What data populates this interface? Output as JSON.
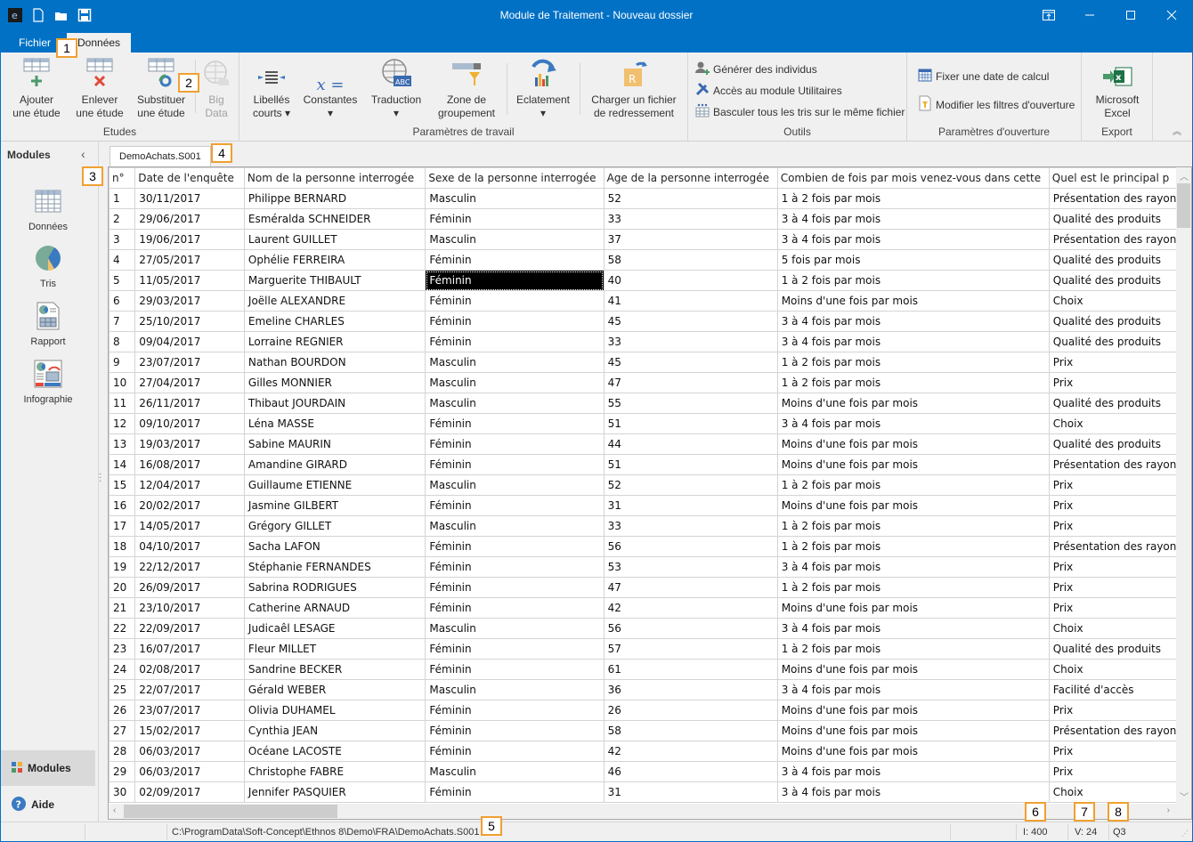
{
  "window": {
    "title": "Module de Traitement - Nouveau dossier",
    "qat": [
      "app-logo-icon",
      "new-file-icon",
      "open-folder-icon",
      "save-icon"
    ],
    "controls": [
      "ribbon-display-icon",
      "minimize-icon",
      "maximize-icon",
      "close-icon"
    ]
  },
  "tabs": [
    {
      "label": "Fichier"
    },
    {
      "label": "Données",
      "active": true
    }
  ],
  "ribbon": {
    "groups": {
      "etudes": {
        "label": "Etudes",
        "buttons": [
          {
            "line1": "Ajouter",
            "line2": "une étude"
          },
          {
            "line1": "Enlever",
            "line2": "une étude"
          },
          {
            "line1": "Substituer",
            "line2": "une étude"
          },
          {
            "line1": "Big",
            "line2": "Data",
            "disabled": true
          }
        ]
      },
      "parametres": {
        "label": "Paramètres de travail",
        "buttons": [
          {
            "line1": "Libellés",
            "line2": "courts ▾"
          },
          {
            "line1": "Constantes",
            "line2": "▾"
          },
          {
            "line1": "Traduction",
            "line2": "▾"
          },
          {
            "line1": "Zone de",
            "line2": "groupement"
          },
          {
            "line1": "Eclatement",
            "line2": "▾"
          },
          {
            "line1": "Charger un fichier",
            "line2": "de redressement"
          }
        ]
      },
      "outils": {
        "label": "Outils",
        "items": [
          "Générer des individus",
          "Accès au module Utilitaires",
          "Basculer tous les tris sur le même fichier"
        ]
      },
      "ouverture": {
        "label": "Paramètres d'ouverture",
        "items": [
          "Fixer une date de calcul",
          "Modifier les filtres d'ouverture"
        ]
      },
      "export": {
        "label": "Export",
        "button": {
          "line1": "Microsoft",
          "line2": "Excel"
        }
      }
    }
  },
  "sidebar": {
    "title": "Modules",
    "items": [
      {
        "label": "Données"
      },
      {
        "label": "Tris"
      },
      {
        "label": "Rapport"
      },
      {
        "label": "Infographie"
      }
    ],
    "bottom": [
      {
        "label": "Modules"
      },
      {
        "label": "Aide"
      }
    ]
  },
  "doc_tab": "DemoAchats.S001",
  "table": {
    "columns": [
      "n°",
      "Date de l'enquête",
      "Nom de la personne interrogée",
      "Sexe de la personne interrogée",
      "Age de la personne interrogée",
      "Combien de fois par mois venez-vous dans cette",
      "Quel est le principal p"
    ],
    "selected": {
      "row": 5,
      "col": 3
    },
    "rows": [
      [
        "1",
        "30/11/2017",
        "Philippe BERNARD",
        "Masculin",
        "52",
        "1 à 2 fois par mois",
        "Présentation des rayons"
      ],
      [
        "2",
        "29/06/2017",
        "Esméralda SCHNEIDER",
        "Féminin",
        "33",
        "3 à 4 fois par mois",
        "Qualité des produits"
      ],
      [
        "3",
        "19/06/2017",
        "Laurent GUILLET",
        "Masculin",
        "37",
        "3 à 4 fois par mois",
        "Présentation des rayons"
      ],
      [
        "4",
        "27/05/2017",
        "Ophélie FERREIRA",
        "Féminin",
        "58",
        "5 fois par mois",
        "Qualité des produits"
      ],
      [
        "5",
        "11/05/2017",
        "Marguerite THIBAULT",
        "Féminin",
        "40",
        "1 à 2 fois par mois",
        "Qualité des produits"
      ],
      [
        "6",
        "29/03/2017",
        "Joëlle ALEXANDRE",
        "Féminin",
        "41",
        "Moins d'une fois par mois",
        "Choix"
      ],
      [
        "7",
        "25/10/2017",
        "Emeline CHARLES",
        "Féminin",
        "45",
        "3 à 4 fois par mois",
        "Qualité des produits"
      ],
      [
        "8",
        "09/04/2017",
        "Lorraine REGNIER",
        "Féminin",
        "33",
        "3 à 4 fois par mois",
        "Qualité des produits"
      ],
      [
        "9",
        "23/07/2017",
        "Nathan BOURDON",
        "Masculin",
        "45",
        "1 à 2 fois par mois",
        "Prix"
      ],
      [
        "10",
        "27/04/2017",
        "Gilles MONNIER",
        "Masculin",
        "47",
        "1 à 2 fois par mois",
        "Prix"
      ],
      [
        "11",
        "26/11/2017",
        "Thibaut JOURDAIN",
        "Masculin",
        "55",
        "Moins d'une fois par mois",
        "Qualité des produits"
      ],
      [
        "12",
        "09/10/2017",
        "Léna MASSE",
        "Féminin",
        "51",
        "3 à 4 fois par mois",
        "Choix"
      ],
      [
        "13",
        "19/03/2017",
        "Sabine MAURIN",
        "Féminin",
        "44",
        "Moins d'une fois par mois",
        "Qualité des produits"
      ],
      [
        "14",
        "16/08/2017",
        "Amandine GIRARD",
        "Féminin",
        "51",
        "Moins d'une fois par mois",
        "Présentation des rayons"
      ],
      [
        "15",
        "12/04/2017",
        "Guillaume ETIENNE",
        "Masculin",
        "52",
        "1 à 2 fois par mois",
        "Prix"
      ],
      [
        "16",
        "20/02/2017",
        "Jasmine GILBERT",
        "Féminin",
        "31",
        "Moins d'une fois par mois",
        "Prix"
      ],
      [
        "17",
        "14/05/2017",
        "Grégory GILLET",
        "Masculin",
        "33",
        "1 à 2 fois par mois",
        "Prix"
      ],
      [
        "18",
        "04/10/2017",
        "Sacha LAFON",
        "Féminin",
        "56",
        "1 à 2 fois par mois",
        "Présentation des rayons"
      ],
      [
        "19",
        "22/12/2017",
        "Stéphanie FERNANDES",
        "Féminin",
        "53",
        "3 à 4 fois par mois",
        "Prix"
      ],
      [
        "20",
        "26/09/2017",
        "Sabrina RODRIGUES",
        "Féminin",
        "47",
        "1 à 2 fois par mois",
        "Prix"
      ],
      [
        "21",
        "23/10/2017",
        "Catherine ARNAUD",
        "Féminin",
        "42",
        "Moins d'une fois par mois",
        "Prix"
      ],
      [
        "22",
        "22/09/2017",
        "Judicaêl LESAGE",
        "Masculin",
        "56",
        "3 à 4 fois par mois",
        "Choix"
      ],
      [
        "23",
        "16/07/2017",
        "Fleur MILLET",
        "Féminin",
        "57",
        "1 à 2 fois par mois",
        "Qualité des produits"
      ],
      [
        "24",
        "02/08/2017",
        "Sandrine BECKER",
        "Féminin",
        "61",
        "Moins d'une fois par mois",
        "Choix"
      ],
      [
        "25",
        "22/07/2017",
        "Gérald WEBER",
        "Masculin",
        "36",
        "3 à 4 fois par mois",
        "Facilité d'accès"
      ],
      [
        "26",
        "23/07/2017",
        "Olivia DUHAMEL",
        "Féminin",
        "26",
        "Moins d'une fois par mois",
        "Prix"
      ],
      [
        "27",
        "15/02/2017",
        "Cynthia JEAN",
        "Féminin",
        "58",
        "Moins d'une fois par mois",
        "Présentation des rayons"
      ],
      [
        "28",
        "06/03/2017",
        "Océane LACOSTE",
        "Féminin",
        "42",
        "Moins d'une fois par mois",
        "Prix"
      ],
      [
        "29",
        "06/03/2017",
        "Christophe FABRE",
        "Masculin",
        "46",
        "3 à 4 fois par mois",
        "Prix"
      ],
      [
        "30",
        "02/09/2017",
        "Jennifer PASQUIER",
        "Féminin",
        "31",
        "3 à 4 fois par mois",
        "Choix"
      ]
    ]
  },
  "status": {
    "path": "C:\\ProgramData\\Soft-Concept\\Ethnos 8\\Demo\\FRA\\DemoAchats.S001",
    "individuals": "I: 400",
    "variables": "V: 24",
    "question": "Q3"
  },
  "callouts": [
    "1",
    "2",
    "3",
    "4",
    "5",
    "6",
    "7",
    "8"
  ],
  "colors": {
    "titlebar": "#0071c5",
    "callout_border": "#f0a030",
    "selection": "#000000"
  }
}
